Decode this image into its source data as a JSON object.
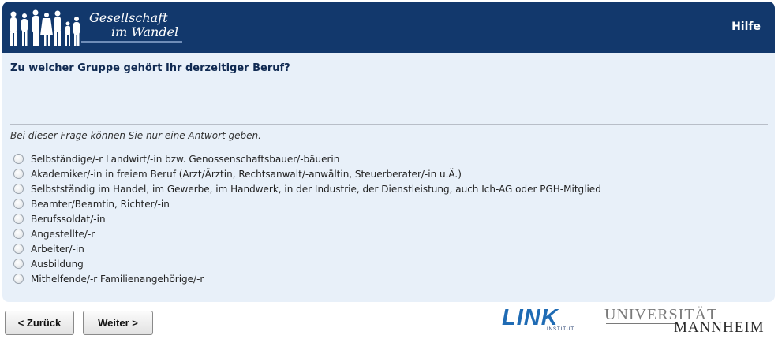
{
  "header": {
    "logo_line1": "Gesellschaft",
    "logo_line2": "im Wandel",
    "help_label": "Hilfe"
  },
  "question": {
    "text": "Zu welcher Gruppe gehört Ihr derzeitiger Beruf?",
    "hint": "Bei dieser Frage können Sie nur eine Antwort geben.",
    "options": [
      "Selbständige/-r Landwirt/-in bzw. Genossenschaftsbauer/-bäuerin",
      "Akademiker/-in in freiem Beruf (Arzt/Ärztin, Rechtsanwalt/-anwältin, Steuerberater/-in u.Ä.)",
      "Selbstständig im Handel, im Gewerbe, im Handwerk, in der Industrie, der Dienstleistung, auch Ich-AG oder PGH-Mitglied",
      "Beamter/Beamtin, Richter/-in",
      "Berufssoldat/-in",
      "Angestellte/-r",
      "Arbeiter/-in",
      "Ausbildung",
      "Mithelfende/-r Familienangehörige/-r"
    ]
  },
  "nav": {
    "back_label": "< Zurück",
    "next_label": "Weiter >"
  },
  "footer": {
    "link_logo": "LINK",
    "link_sub": "INSTITUT",
    "uni_line1": "UNIVERSITÄT",
    "uni_line2": "MANNHEIM"
  },
  "colors": {
    "header_bg": "#12386c",
    "panel_bg": "#e8f0f9",
    "link_blue": "#1f6bb4"
  }
}
